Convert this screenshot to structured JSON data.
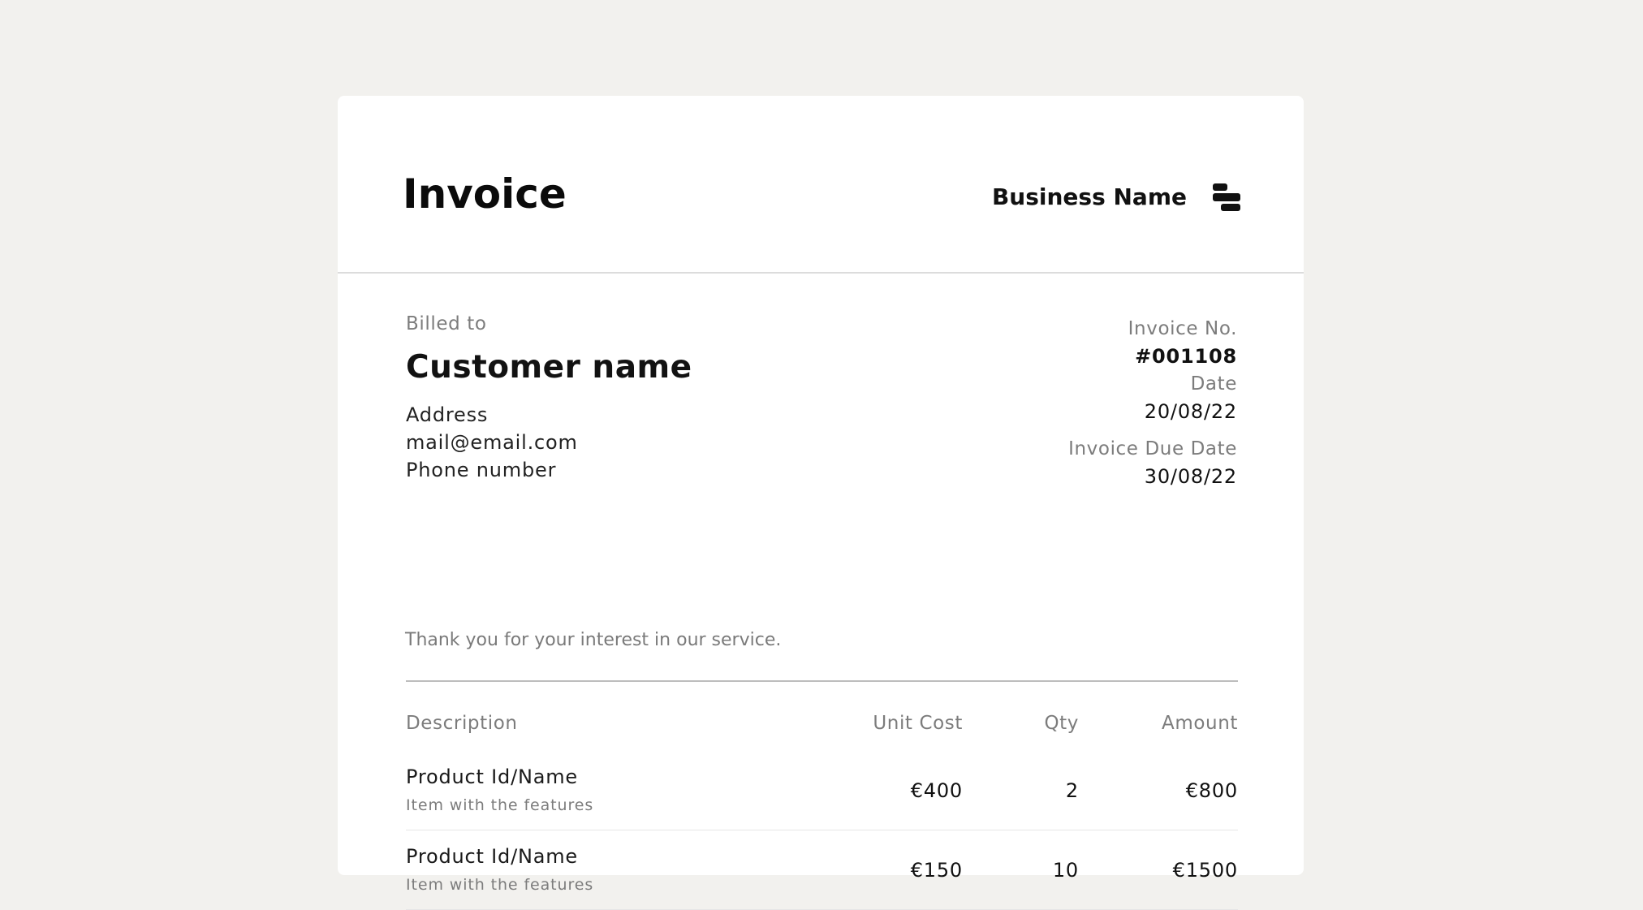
{
  "header": {
    "title": "Invoice",
    "business_name": "Business Name",
    "logo_icon": "stacked-bars-logo-icon"
  },
  "billed_to": {
    "label": "Billed to",
    "customer_name": "Customer name",
    "address": "Address",
    "email": "mail@email.com",
    "phone": "Phone number"
  },
  "meta": {
    "invoice_no_label": "Invoice No.",
    "invoice_no": "#001108",
    "date_label": "Date",
    "date": "20/08/22",
    "due_date_label": "Invoice Due Date",
    "due_date": "30/08/22"
  },
  "message": "Thank you for your interest in our service.",
  "table": {
    "headers": {
      "description": "Description",
      "unit_cost": "Unit Cost",
      "qty": "Qty",
      "amount": "Amount"
    },
    "rows": [
      {
        "name": "Product Id/Name",
        "desc": "Item with the features",
        "unit_cost": "€400",
        "qty": "2",
        "amount": "€800"
      },
      {
        "name": "Product Id/Name",
        "desc": "Item with the features",
        "unit_cost": "€150",
        "qty": "10",
        "amount": "€1500"
      }
    ]
  },
  "colors": {
    "background": "#f2f1ee",
    "card": "#ffffff",
    "text": "#111111",
    "muted": "#7c7c7c"
  }
}
